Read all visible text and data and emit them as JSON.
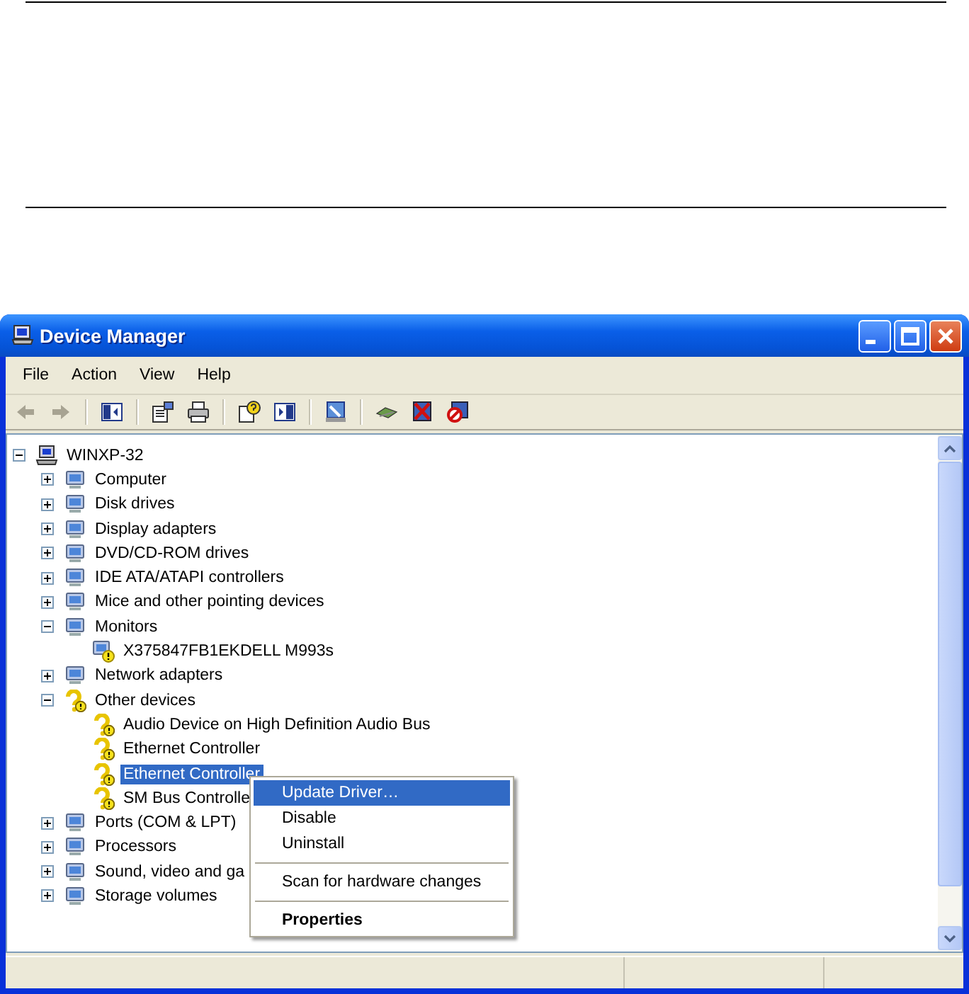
{
  "window": {
    "title": "Device Manager"
  },
  "menu_bar": [
    "File",
    "Action",
    "View",
    "Help"
  ],
  "toolbar": {
    "back": {
      "disabled": true
    },
    "forward": {
      "disabled": true
    }
  },
  "tree": {
    "label": "WINXP-32",
    "kind": "computer",
    "expanded": true,
    "selected": false,
    "children": [
      {
        "label": "Computer",
        "kind": "device",
        "expanded": false,
        "selected": false
      },
      {
        "label": "Disk drives",
        "kind": "device",
        "expanded": false,
        "selected": false
      },
      {
        "label": "Display adapters",
        "kind": "device",
        "expanded": false,
        "selected": false
      },
      {
        "label": "DVD/CD-ROM drives",
        "kind": "device",
        "expanded": false,
        "selected": false
      },
      {
        "label": "IDE ATA/ATAPI controllers",
        "kind": "device",
        "expanded": false,
        "selected": false
      },
      {
        "label": "Mice and other pointing devices",
        "kind": "device",
        "expanded": false,
        "selected": false
      },
      {
        "label": "Monitors",
        "kind": "device",
        "expanded": true,
        "selected": false,
        "children": [
          {
            "label": "X375847FB1EKDELL M993s",
            "kind": "problem",
            "selected": false
          }
        ]
      },
      {
        "label": "Network adapters",
        "kind": "device",
        "expanded": false,
        "selected": false
      },
      {
        "label": "Other devices",
        "kind": "unknown",
        "expanded": true,
        "selected": false,
        "children": [
          {
            "label": "Audio Device on High Definition Audio Bus",
            "kind": "unknown",
            "selected": false
          },
          {
            "label": "Ethernet Controller",
            "kind": "unknown",
            "selected": false
          },
          {
            "label": "Ethernet Controller",
            "kind": "unknown",
            "selected": true
          },
          {
            "label": "SM Bus Controlle",
            "kind": "unknown",
            "selected": false
          }
        ]
      },
      {
        "label": "Ports (COM & LPT)",
        "kind": "device",
        "expanded": false,
        "selected": false
      },
      {
        "label": "Processors",
        "kind": "device",
        "expanded": false,
        "selected": false
      },
      {
        "label": "Sound, video and ga",
        "kind": "device",
        "expanded": false,
        "selected": false
      },
      {
        "label": "Storage volumes",
        "kind": "device",
        "expanded": false,
        "selected": false
      }
    ]
  },
  "context_menu": {
    "groups": [
      [
        {
          "label": "Update Driver…",
          "selected": true,
          "default": false
        },
        {
          "label": "Disable",
          "selected": false,
          "default": false
        },
        {
          "label": "Uninstall",
          "selected": false,
          "default": false
        }
      ],
      [
        {
          "label": "Scan for hardware changes",
          "selected": false,
          "default": false
        }
      ],
      [
        {
          "label": "Properties",
          "selected": false,
          "default": true
        }
      ]
    ]
  }
}
